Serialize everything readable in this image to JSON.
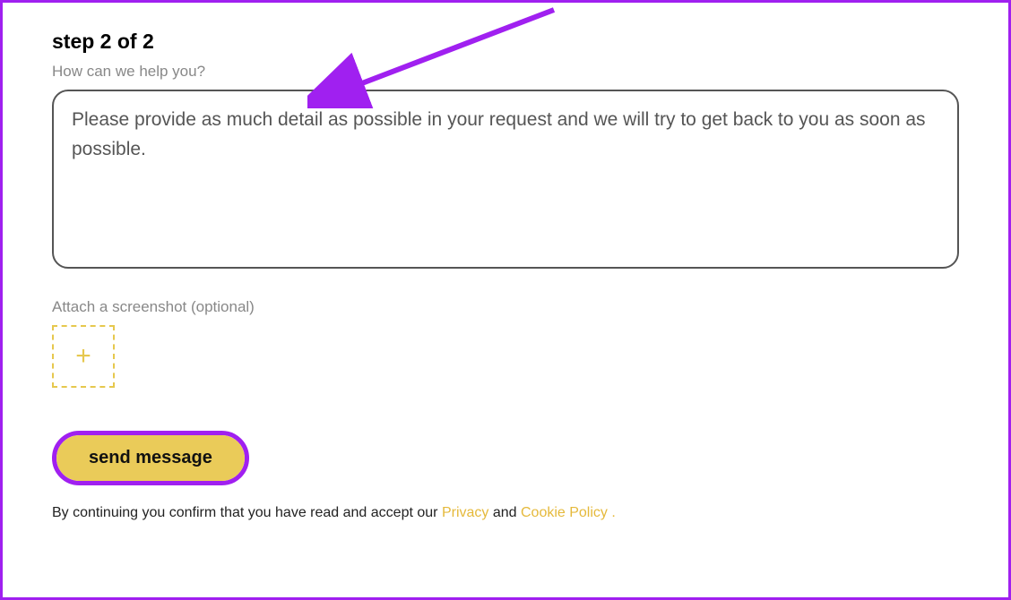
{
  "step_title": "step 2 of 2",
  "help_label": "How can we help you?",
  "message_placeholder": "Please provide as much detail as possible in your request and we will try to get back to you as soon as possible.",
  "attach_label": "Attach a screenshot (optional)",
  "send_label": "send message",
  "disclaimer_prefix": "By continuing you confirm that you have read and accept our ",
  "privacy_label": "Privacy",
  "disclaimer_and": " and ",
  "cookie_label": "Cookie Policy .",
  "colors": {
    "accent_purple": "#a020f0",
    "accent_yellow": "#eacb59",
    "upload_dash": "#e6c84e",
    "link": "#e5b93b"
  }
}
